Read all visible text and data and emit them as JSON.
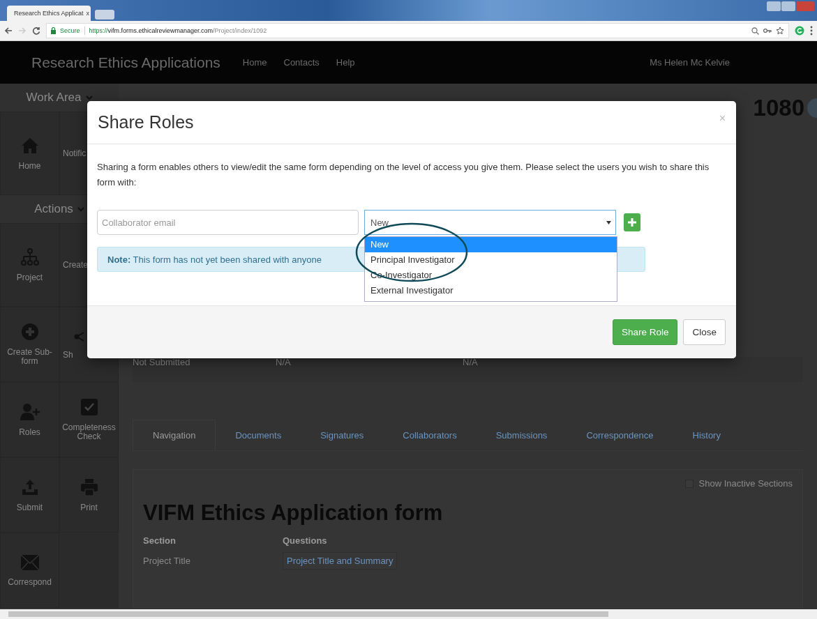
{
  "browser": {
    "tab_title": "Research Ethics Applicat",
    "tab_close": "x",
    "secure_label": "Secure",
    "url_scheme": "https://",
    "url_host": "vifm.forms.ethicalreviewmanager.com",
    "url_path": "/Project/index/1092"
  },
  "navbar": {
    "brand": "Research Ethics Applications",
    "links": [
      "Home",
      "Contacts",
      "Help"
    ],
    "user": "Ms Helen Mc Kelvie"
  },
  "sidebar": {
    "sections": [
      {
        "title": "Work Area",
        "tiles": [
          {
            "label": "Home",
            "kind": "home"
          },
          {
            "label": "Notific",
            "kind": "none"
          }
        ]
      },
      {
        "title": "Actions",
        "tiles": [
          {
            "label": "Project",
            "kind": "hierarchy"
          },
          {
            "label": "Create",
            "kind": "none"
          },
          {
            "label": "Create Sub-form",
            "kind": "plus"
          },
          {
            "label": "Sh",
            "kind": "share"
          },
          {
            "label": "Roles",
            "kind": "user"
          },
          {
            "label": "Completeness Check",
            "kind": "check"
          },
          {
            "label": "Submit",
            "kind": "upload"
          },
          {
            "label": "Print",
            "kind": "printer"
          },
          {
            "label": "Correspond",
            "kind": "envelope"
          }
        ]
      }
    ]
  },
  "project": {
    "number": "1080"
  },
  "status_row": [
    "Not Submitted",
    "N/A",
    "N/A"
  ],
  "tabs": [
    {
      "label": "Navigation",
      "selected": true
    },
    {
      "label": "Documents",
      "selected": false
    },
    {
      "label": "Signatures",
      "selected": false
    },
    {
      "label": "Collaborators",
      "selected": false
    },
    {
      "label": "Submissions",
      "selected": false
    },
    {
      "label": "Correspondence",
      "selected": false
    },
    {
      "label": "History",
      "selected": false
    }
  ],
  "form": {
    "show_inactive": {
      "label": "Show Inactive Sections",
      "checked": false
    },
    "title": "VIFM Ethics Application form",
    "columns": [
      "Section",
      "Questions"
    ],
    "rows": [
      {
        "section": "Project Title",
        "question": "Project Title and Summary"
      }
    ]
  },
  "modal": {
    "title": "Share Roles",
    "close": "×",
    "intro": "Sharing a form enables others to view/edit the same form depending on the level of access you give them. Please select the users you wish to share this form with:",
    "email_placeholder": "Collaborator email",
    "role_value": "New",
    "role_options": [
      {
        "label": "New",
        "selected": true
      },
      {
        "label": "Principal Investigator",
        "selected": false
      },
      {
        "label": "Co-Investigator",
        "selected": false
      },
      {
        "label": "External Investigator",
        "selected": false
      }
    ],
    "note": "**Note:** This form has not yet been shared with anyone",
    "buttons": [
      {
        "label": "Share Role",
        "kind": "primary"
      },
      {
        "label": "Close",
        "kind": "default"
      }
    ]
  }
}
